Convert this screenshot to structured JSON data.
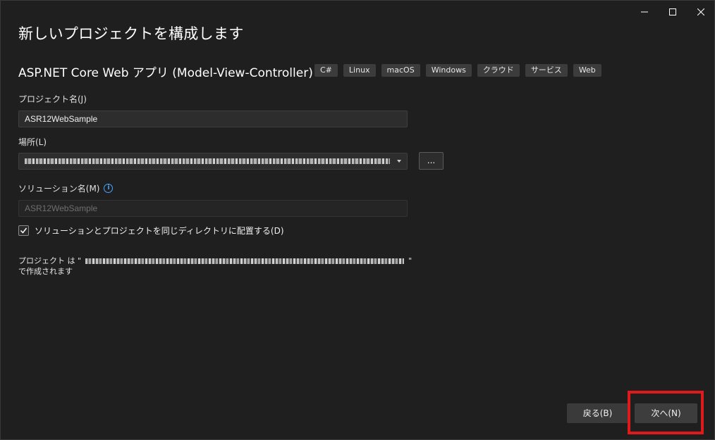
{
  "window": {
    "controls": {
      "minimize_icon": "minimize-icon",
      "maximize_icon": "maximize-icon",
      "close_icon": "close-icon"
    }
  },
  "title": "新しいプロジェクトを構成します",
  "template": {
    "name": "ASP.NET Core Web アプリ (Model-View-Controller)",
    "tags": [
      "C#",
      "Linux",
      "macOS",
      "Windows",
      "クラウド",
      "サービス",
      "Web"
    ]
  },
  "project_name": {
    "label": "プロジェクト名(J)",
    "value": "ASR12WebSample"
  },
  "location": {
    "label": "場所(L)",
    "browse_label": "..."
  },
  "solution_name": {
    "label": "ソリューション名(M)",
    "value": "ASR12WebSample"
  },
  "same_directory": {
    "label": "ソリューションとプロジェクトを同じディレクトリに配置する(D)",
    "checked": true
  },
  "note": {
    "prefix": "プロジェクト は \"",
    "suffix": "\"",
    "line2": "で作成されます"
  },
  "buttons": {
    "back": "戻る(B)",
    "next": "次へ(N)"
  },
  "colors": {
    "background": "#1f1f1f",
    "highlight": "#e01a1a",
    "info": "#4aa3ff"
  }
}
